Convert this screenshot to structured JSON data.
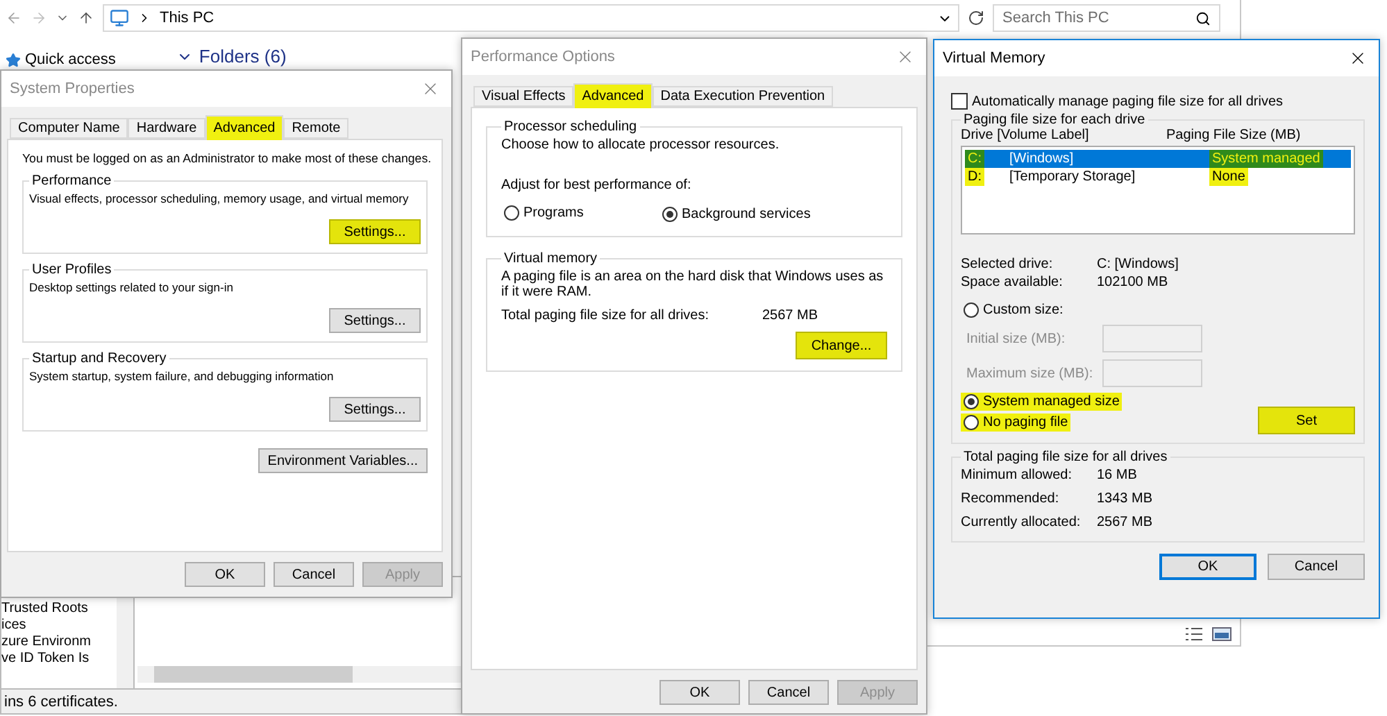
{
  "explorer": {
    "path": "This PC",
    "search": {
      "placeholder": "Search This PC"
    },
    "quick_access": "Quick access",
    "folders_heading": "Folders (6)"
  },
  "cert_console": {
    "tree_items": [
      "Trusted Roots",
      "ices",
      "zure Environm",
      "ve ID Token Is"
    ],
    "status": "ins 6 certificates."
  },
  "system_properties": {
    "title": "System Properties",
    "tabs": [
      {
        "label": "Computer Name",
        "selected": false,
        "highlighted": false
      },
      {
        "label": "Hardware",
        "selected": false,
        "highlighted": false
      },
      {
        "label": "Advanced",
        "selected": true,
        "highlighted": true
      },
      {
        "label": "Remote",
        "selected": false,
        "highlighted": false
      }
    ],
    "notice": "You must be logged on as an Administrator to make most of these changes.",
    "groups": [
      {
        "title": "Performance",
        "description": "Visual effects, processor scheduling, memory usage, and virtual memory",
        "button": {
          "label": "Settings...",
          "highlighted": true
        }
      },
      {
        "title": "User Profiles",
        "description": "Desktop settings related to your sign-in",
        "button": {
          "label": "Settings...",
          "highlighted": false
        }
      },
      {
        "title": "Startup and Recovery",
        "description": "System startup, system failure, and debugging information",
        "button": {
          "label": "Settings...",
          "highlighted": false
        }
      }
    ],
    "env_button": "Environment Variables...",
    "buttons": [
      {
        "label": "OK",
        "disabled": false
      },
      {
        "label": "Cancel",
        "disabled": false
      },
      {
        "label": "Apply",
        "disabled": true
      }
    ]
  },
  "performance_options": {
    "title": "Performance Options",
    "tabs": [
      {
        "label": "Visual Effects",
        "selected": false,
        "highlighted": false
      },
      {
        "label": "Advanced",
        "selected": true,
        "highlighted": true
      },
      {
        "label": "Data Execution Prevention",
        "selected": false,
        "highlighted": false
      }
    ],
    "processor_scheduling": {
      "title": "Processor scheduling",
      "text": "Choose how to allocate processor resources.",
      "adjust_label": "Adjust for best performance of:",
      "options": [
        {
          "label": "Programs",
          "selected": false
        },
        {
          "label": "Background services",
          "selected": true
        }
      ]
    },
    "virtual_memory": {
      "title": "Virtual memory",
      "text": "A paging file is an area on the hard disk that Windows uses as if it were RAM.",
      "total_label": "Total paging file size for all drives:",
      "total_value": "2567 MB",
      "button": {
        "label": "Change...",
        "highlighted": true
      }
    },
    "buttons": [
      {
        "label": "OK",
        "disabled": false
      },
      {
        "label": "Cancel",
        "disabled": false
      },
      {
        "label": "Apply",
        "disabled": true
      }
    ]
  },
  "virtual_memory": {
    "title": "Virtual Memory",
    "auto_manage": {
      "label": "Automatically manage paging file size for all drives",
      "checked": false
    },
    "group_title": "Paging file size for each drive",
    "columns": [
      "Drive  [Volume Label]",
      "Paging File Size (MB)"
    ],
    "drives": [
      {
        "drive": "C:",
        "label": "[Windows]",
        "size": "System managed",
        "selected": true,
        "highlighted": true
      },
      {
        "drive": "D:",
        "label": "[Temporary Storage]",
        "size": "None",
        "selected": false,
        "highlighted": true
      }
    ],
    "info": [
      {
        "label": "Selected drive:",
        "value": "C:  [Windows]"
      },
      {
        "label": "Space available:",
        "value": "102100 MB"
      }
    ],
    "custom_size": {
      "label": "Custom size:",
      "selected": false
    },
    "fields": [
      {
        "label": "Initial size (MB):",
        "disabled": true
      },
      {
        "label": "Maximum size (MB):",
        "disabled": true
      }
    ],
    "size_options": [
      {
        "label": "System managed size",
        "selected": true,
        "highlighted": true
      },
      {
        "label": "No paging file",
        "selected": false,
        "highlighted": true
      }
    ],
    "set_button": {
      "label": "Set",
      "highlighted": true
    },
    "totals_title": "Total paging file size for all drives",
    "totals": [
      {
        "label": "Minimum allowed:",
        "value": "16 MB"
      },
      {
        "label": "Recommended:",
        "value": "1343 MB"
      },
      {
        "label": "Currently allocated:",
        "value": "2567 MB"
      }
    ],
    "buttons": [
      {
        "label": "OK",
        "default": true
      },
      {
        "label": "Cancel",
        "default": false
      }
    ]
  }
}
